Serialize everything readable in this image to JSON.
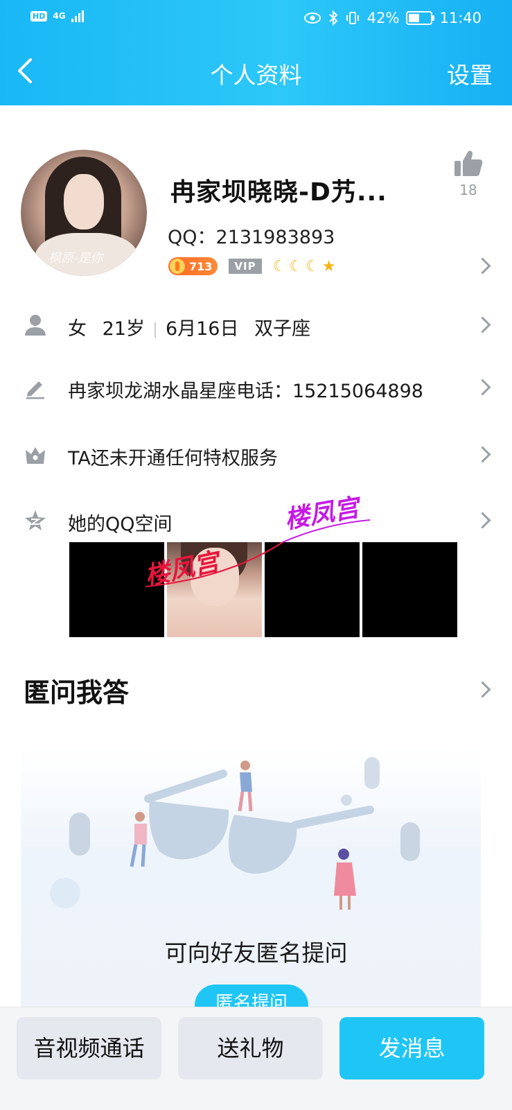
{
  "status_bar": {
    "network": "4G",
    "battery": "42%",
    "time": "11:40"
  },
  "nav": {
    "title": "个人资料",
    "settings": "设置"
  },
  "profile": {
    "name": "冉家坝晓晓-D艿...",
    "qq_label": "QQ：",
    "qq_number": "2131983893",
    "coin_level": "713",
    "vip": "VIP",
    "likes": "18",
    "avatar_watermark": "枫原-是你"
  },
  "info": {
    "gender": "女",
    "age": "21岁",
    "birthday": "6月16日",
    "zodiac": "双子座",
    "signature": "冉家坝龙湖水晶星座电话：15215064898",
    "privilege": "TA还未开通任何特权服务",
    "qzone": "她的QQ空间"
  },
  "watermarks": {
    "a": "楼凤宫",
    "b": "楼凤宫"
  },
  "qa": {
    "title": "匿问我答",
    "prompt": "可向好友匿名提问",
    "ask_button": "匿名提问"
  },
  "bottom": {
    "call": "音视频通话",
    "gift": "送礼物",
    "message": "发消息"
  },
  "colors": {
    "accent": "#1fc6f5",
    "header": "#19b8f5",
    "coin": "#ff7a1a",
    "moon": "#f7b514"
  }
}
